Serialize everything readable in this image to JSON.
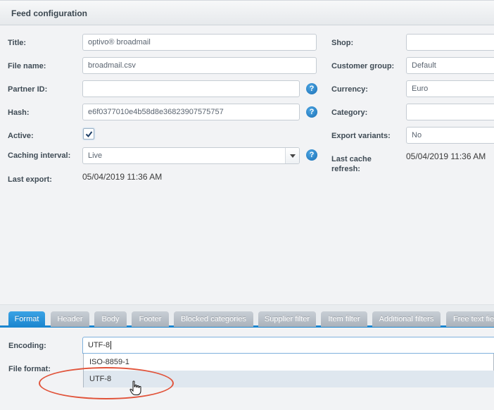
{
  "panel": {
    "title": "Feed configuration"
  },
  "left": {
    "title_label": "Title:",
    "title_value": "optivo® broadmail",
    "filename_label": "File name:",
    "filename_value": "broadmail.csv",
    "partner_label": "Partner ID:",
    "partner_value": "",
    "hash_label": "Hash:",
    "hash_value": "e6f0377010e4b58d8e36823907575757",
    "active_label": "Active:",
    "active_checked": true,
    "caching_label": "Caching interval:",
    "caching_value": "Live",
    "lastexport_label": "Last export:",
    "lastexport_value": "05/04/2019 11:36 AM"
  },
  "right": {
    "shop_label": "Shop:",
    "shop_value": "",
    "custgroup_label": "Customer group:",
    "custgroup_value": "Default",
    "currency_label": "Currency:",
    "currency_value": "Euro",
    "category_label": "Category:",
    "category_value": "",
    "variants_label": "Export variants:",
    "variants_value": "No",
    "lastcache_label_1": "Last cache",
    "lastcache_label_2": "refresh:",
    "lastcache_value": "05/04/2019 11:36 AM"
  },
  "help_glyph": "?",
  "tabs": [
    {
      "label": "Format",
      "active": true
    },
    {
      "label": "Header"
    },
    {
      "label": "Body"
    },
    {
      "label": "Footer"
    },
    {
      "label": "Blocked categories"
    },
    {
      "label": "Supplier filter"
    },
    {
      "label": "Item filter"
    },
    {
      "label": "Additional filters"
    },
    {
      "label": "Free text fie"
    }
  ],
  "format": {
    "encoding_label": "Encoding:",
    "encoding_value": "UTF-8",
    "fileformat_label": "File format:",
    "options": [
      "ISO-8859-1",
      "UTF-8"
    ],
    "hovered_option": "UTF-8"
  },
  "colors": {
    "accent": "#1b86cf",
    "highlight_ring": "#e1533a"
  },
  "icons": {
    "help": "help-icon",
    "check": "checkmark-icon",
    "dropdown": "chevron-down-icon",
    "cursor": "hand-pointer-icon"
  }
}
